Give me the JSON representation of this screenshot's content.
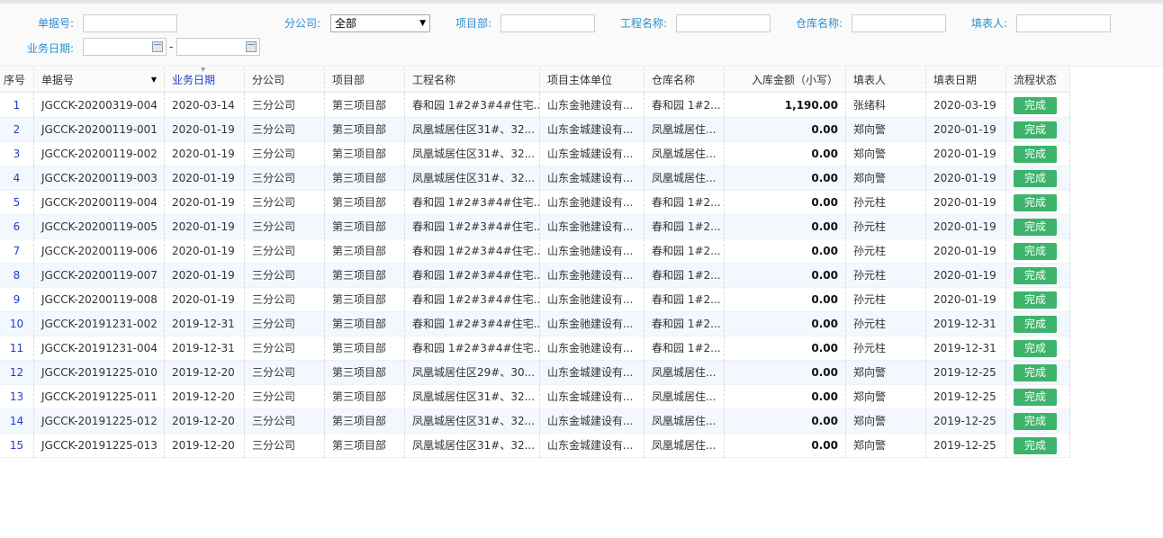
{
  "filters": {
    "doc_no_label": "单据号:",
    "branch_label": "分公司:",
    "branch_selected": "全部",
    "dept_label": "项目部:",
    "project_label": "工程名称:",
    "warehouse_label": "仓库名称:",
    "filler_label": "填表人:",
    "date_label": "业务日期:",
    "date_sep": "-"
  },
  "table": {
    "headers": {
      "idx": "序号",
      "doc_no": "单据号",
      "biz_date": "业务日期",
      "branch": "分公司",
      "dept": "项目部",
      "project": "工程名称",
      "owner": "项目主体单位",
      "warehouse": "仓库名称",
      "amount": "入库金额（小写）",
      "filler": "填表人",
      "fill_date": "填表日期",
      "status": "流程状态"
    },
    "rows": [
      {
        "idx": "1",
        "doc_no": "JGCCK-20200319-004",
        "biz_date": "2020-03-14",
        "branch": "三分公司",
        "dept": "第三项目部",
        "project": "春和园 1#2#3#4#住宅...",
        "owner": "山东金驰建设有...",
        "warehouse": "春和园 1#2...",
        "amount": "1,190.00",
        "filler": "张绪科",
        "fill_date": "2020-03-19",
        "status": "完成"
      },
      {
        "idx": "2",
        "doc_no": "JGCCK-20200119-001",
        "biz_date": "2020-01-19",
        "branch": "三分公司",
        "dept": "第三项目部",
        "project": "凤凰城居住区31#、32...",
        "owner": "山东金城建设有...",
        "warehouse": "凤凰城居住...",
        "amount": "0.00",
        "filler": "郑向警",
        "fill_date": "2020-01-19",
        "status": "完成"
      },
      {
        "idx": "3",
        "doc_no": "JGCCK-20200119-002",
        "biz_date": "2020-01-19",
        "branch": "三分公司",
        "dept": "第三项目部",
        "project": "凤凰城居住区31#、32...",
        "owner": "山东金城建设有...",
        "warehouse": "凤凰城居住...",
        "amount": "0.00",
        "filler": "郑向警",
        "fill_date": "2020-01-19",
        "status": "完成"
      },
      {
        "idx": "4",
        "doc_no": "JGCCK-20200119-003",
        "biz_date": "2020-01-19",
        "branch": "三分公司",
        "dept": "第三项目部",
        "project": "凤凰城居住区31#、32...",
        "owner": "山东金城建设有...",
        "warehouse": "凤凰城居住...",
        "amount": "0.00",
        "filler": "郑向警",
        "fill_date": "2020-01-19",
        "status": "完成"
      },
      {
        "idx": "5",
        "doc_no": "JGCCK-20200119-004",
        "biz_date": "2020-01-19",
        "branch": "三分公司",
        "dept": "第三项目部",
        "project": "春和园 1#2#3#4#住宅...",
        "owner": "山东金驰建设有...",
        "warehouse": "春和园 1#2...",
        "amount": "0.00",
        "filler": "孙元柱",
        "fill_date": "2020-01-19",
        "status": "完成"
      },
      {
        "idx": "6",
        "doc_no": "JGCCK-20200119-005",
        "biz_date": "2020-01-19",
        "branch": "三分公司",
        "dept": "第三项目部",
        "project": "春和园 1#2#3#4#住宅...",
        "owner": "山东金驰建设有...",
        "warehouse": "春和园 1#2...",
        "amount": "0.00",
        "filler": "孙元柱",
        "fill_date": "2020-01-19",
        "status": "完成"
      },
      {
        "idx": "7",
        "doc_no": "JGCCK-20200119-006",
        "biz_date": "2020-01-19",
        "branch": "三分公司",
        "dept": "第三项目部",
        "project": "春和园 1#2#3#4#住宅...",
        "owner": "山东金驰建设有...",
        "warehouse": "春和园 1#2...",
        "amount": "0.00",
        "filler": "孙元柱",
        "fill_date": "2020-01-19",
        "status": "完成"
      },
      {
        "idx": "8",
        "doc_no": "JGCCK-20200119-007",
        "biz_date": "2020-01-19",
        "branch": "三分公司",
        "dept": "第三项目部",
        "project": "春和园 1#2#3#4#住宅...",
        "owner": "山东金驰建设有...",
        "warehouse": "春和园 1#2...",
        "amount": "0.00",
        "filler": "孙元柱",
        "fill_date": "2020-01-19",
        "status": "完成"
      },
      {
        "idx": "9",
        "doc_no": "JGCCK-20200119-008",
        "biz_date": "2020-01-19",
        "branch": "三分公司",
        "dept": "第三项目部",
        "project": "春和园 1#2#3#4#住宅...",
        "owner": "山东金驰建设有...",
        "warehouse": "春和园 1#2...",
        "amount": "0.00",
        "filler": "孙元柱",
        "fill_date": "2020-01-19",
        "status": "完成"
      },
      {
        "idx": "10",
        "doc_no": "JGCCK-20191231-002",
        "biz_date": "2019-12-31",
        "branch": "三分公司",
        "dept": "第三项目部",
        "project": "春和园 1#2#3#4#住宅...",
        "owner": "山东金驰建设有...",
        "warehouse": "春和园 1#2...",
        "amount": "0.00",
        "filler": "孙元柱",
        "fill_date": "2019-12-31",
        "status": "完成"
      },
      {
        "idx": "11",
        "doc_no": "JGCCK-20191231-004",
        "biz_date": "2019-12-31",
        "branch": "三分公司",
        "dept": "第三项目部",
        "project": "春和园 1#2#3#4#住宅...",
        "owner": "山东金驰建设有...",
        "warehouse": "春和园 1#2...",
        "amount": "0.00",
        "filler": "孙元柱",
        "fill_date": "2019-12-31",
        "status": "完成"
      },
      {
        "idx": "12",
        "doc_no": "JGCCK-20191225-010",
        "biz_date": "2019-12-20",
        "branch": "三分公司",
        "dept": "第三项目部",
        "project": "凤凰城居住区29#、30...",
        "owner": "山东金城建设有...",
        "warehouse": "凤凰城居住...",
        "amount": "0.00",
        "filler": "郑向警",
        "fill_date": "2019-12-25",
        "status": "完成"
      },
      {
        "idx": "13",
        "doc_no": "JGCCK-20191225-011",
        "biz_date": "2019-12-20",
        "branch": "三分公司",
        "dept": "第三项目部",
        "project": "凤凰城居住区31#、32...",
        "owner": "山东金城建设有...",
        "warehouse": "凤凰城居住...",
        "amount": "0.00",
        "filler": "郑向警",
        "fill_date": "2019-12-25",
        "status": "完成"
      },
      {
        "idx": "14",
        "doc_no": "JGCCK-20191225-012",
        "biz_date": "2019-12-20",
        "branch": "三分公司",
        "dept": "第三项目部",
        "project": "凤凰城居住区31#、32...",
        "owner": "山东金城建设有...",
        "warehouse": "凤凰城居住...",
        "amount": "0.00",
        "filler": "郑向警",
        "fill_date": "2019-12-25",
        "status": "完成"
      },
      {
        "idx": "15",
        "doc_no": "JGCCK-20191225-013",
        "biz_date": "2019-12-20",
        "branch": "三分公司",
        "dept": "第三项目部",
        "project": "凤凰城居住区31#、32...",
        "owner": "山东金城建设有...",
        "warehouse": "凤凰城居住...",
        "amount": "0.00",
        "filler": "郑向警",
        "fill_date": "2019-12-25",
        "status": "完成"
      }
    ]
  },
  "colors": {
    "label_blue": "#2b8fd0",
    "index_blue": "#1f3fc7",
    "status_green": "#3db36b",
    "alt_row": "#f2f8fe"
  }
}
